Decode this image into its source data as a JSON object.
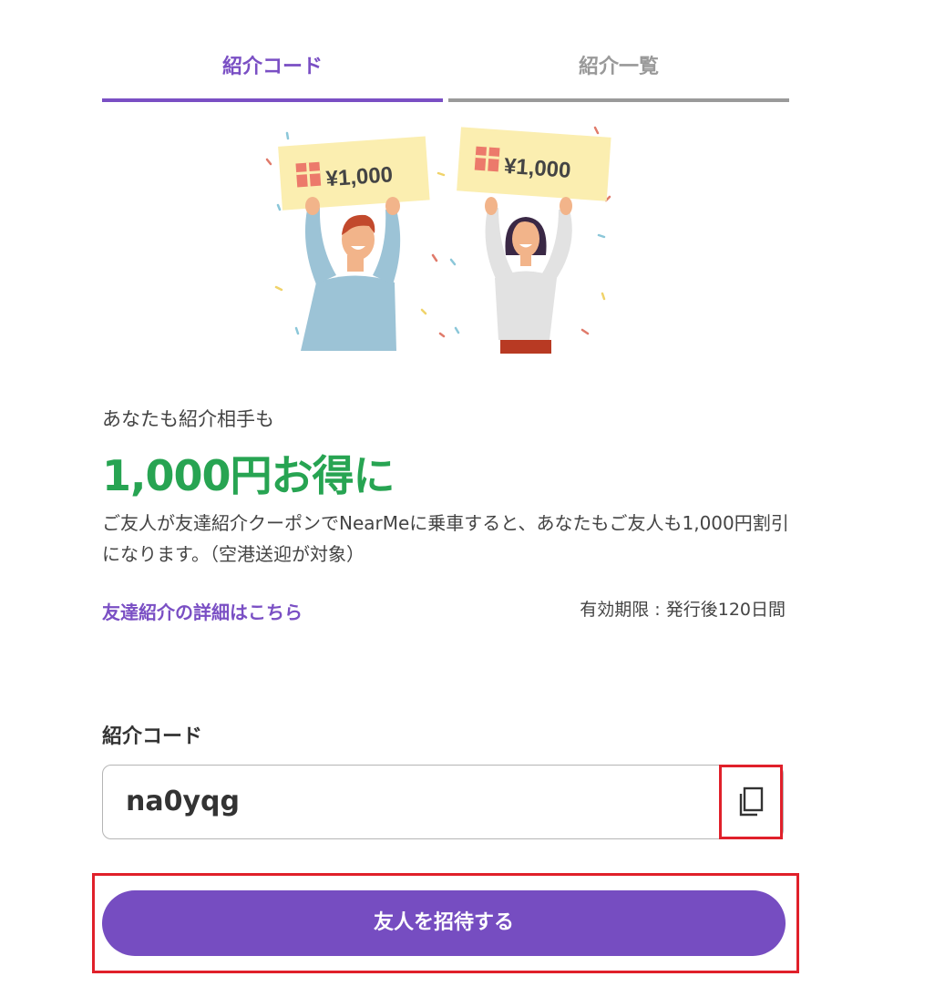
{
  "tabs": [
    {
      "label": "紹介コード",
      "active": true
    },
    {
      "label": "紹介一覧",
      "active": false
    }
  ],
  "hero": {
    "voucher_left": "¥1,000",
    "voucher_right": "¥1,000"
  },
  "content": {
    "subhead": "あなたも紹介相手も",
    "headline": "1,000円お得に",
    "description": "ご友人が友達紹介クーポンでNearMeに乗車すると、あなたもご友人も1,000円割引になります。（空港送迎が対象）",
    "details_link": "友達紹介の詳細はこちら",
    "validity": "有効期限 : 発行後120日間"
  },
  "code_section": {
    "label": "紹介コード",
    "value": "na0yqg",
    "copy_icon": "copy-icon"
  },
  "invite_button": {
    "label": "友人を招待する"
  },
  "colors": {
    "accent_purple": "#764dc1",
    "headline_green": "#27a452",
    "highlight_red": "#e0202a"
  }
}
